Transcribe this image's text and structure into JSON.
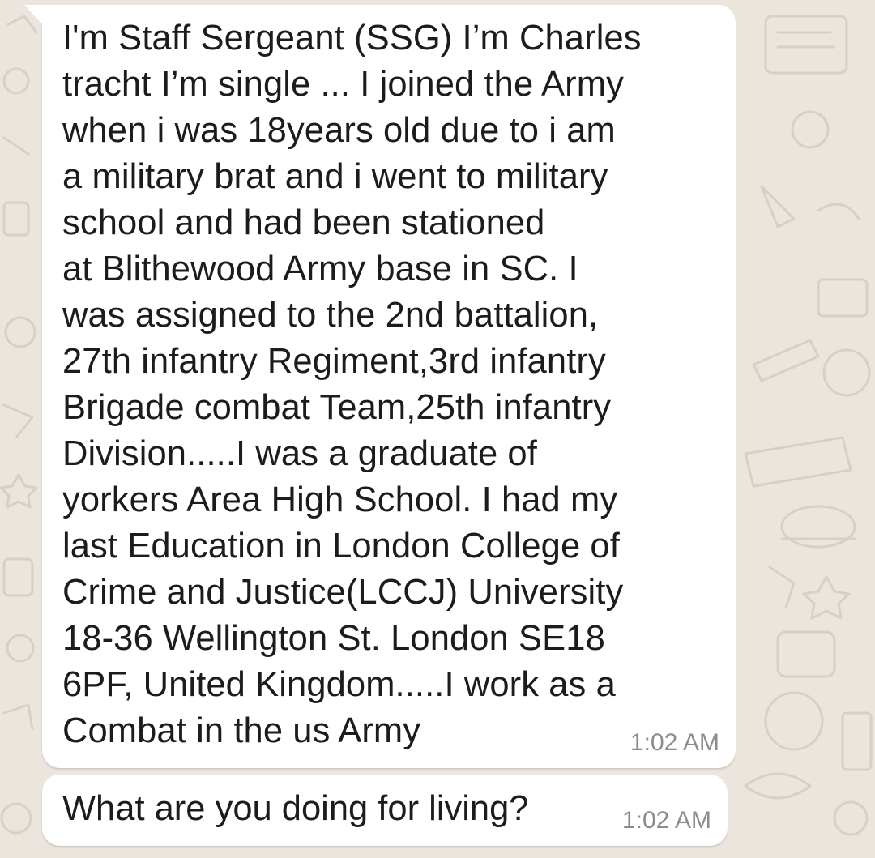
{
  "chat": {
    "messages": [
      {
        "text": "I'm Staff Sergeant (SSG) I’m Charles\ntracht  I’m single ... I joined the Army\nwhen i was 18years old due to i am\na military brat and i went to military\nschool and had been stationed\nat Blithewood Army base in SC. I\nwas assigned to the 2nd battalion,\n27th infantry Regiment,3rd infantry\nBrigade combat Team,25th infantry\nDivision.....I was a graduate of\nyorkers Area High School. I had my\nlast Education in London College of\nCrime and Justice(LCCJ) University\n18-36 Wellington St. London SE18\n6PF, United Kingdom.....I work as a\nCombat  in the us Army",
        "time": "1:02 AM"
      },
      {
        "text": "What are you doing for living?",
        "time": "1:02 AM"
      }
    ]
  },
  "colors": {
    "background": "#ece5dd",
    "bubble": "#ffffff",
    "timestamp": "#8c8c8c",
    "text": "#1c1c1c"
  }
}
